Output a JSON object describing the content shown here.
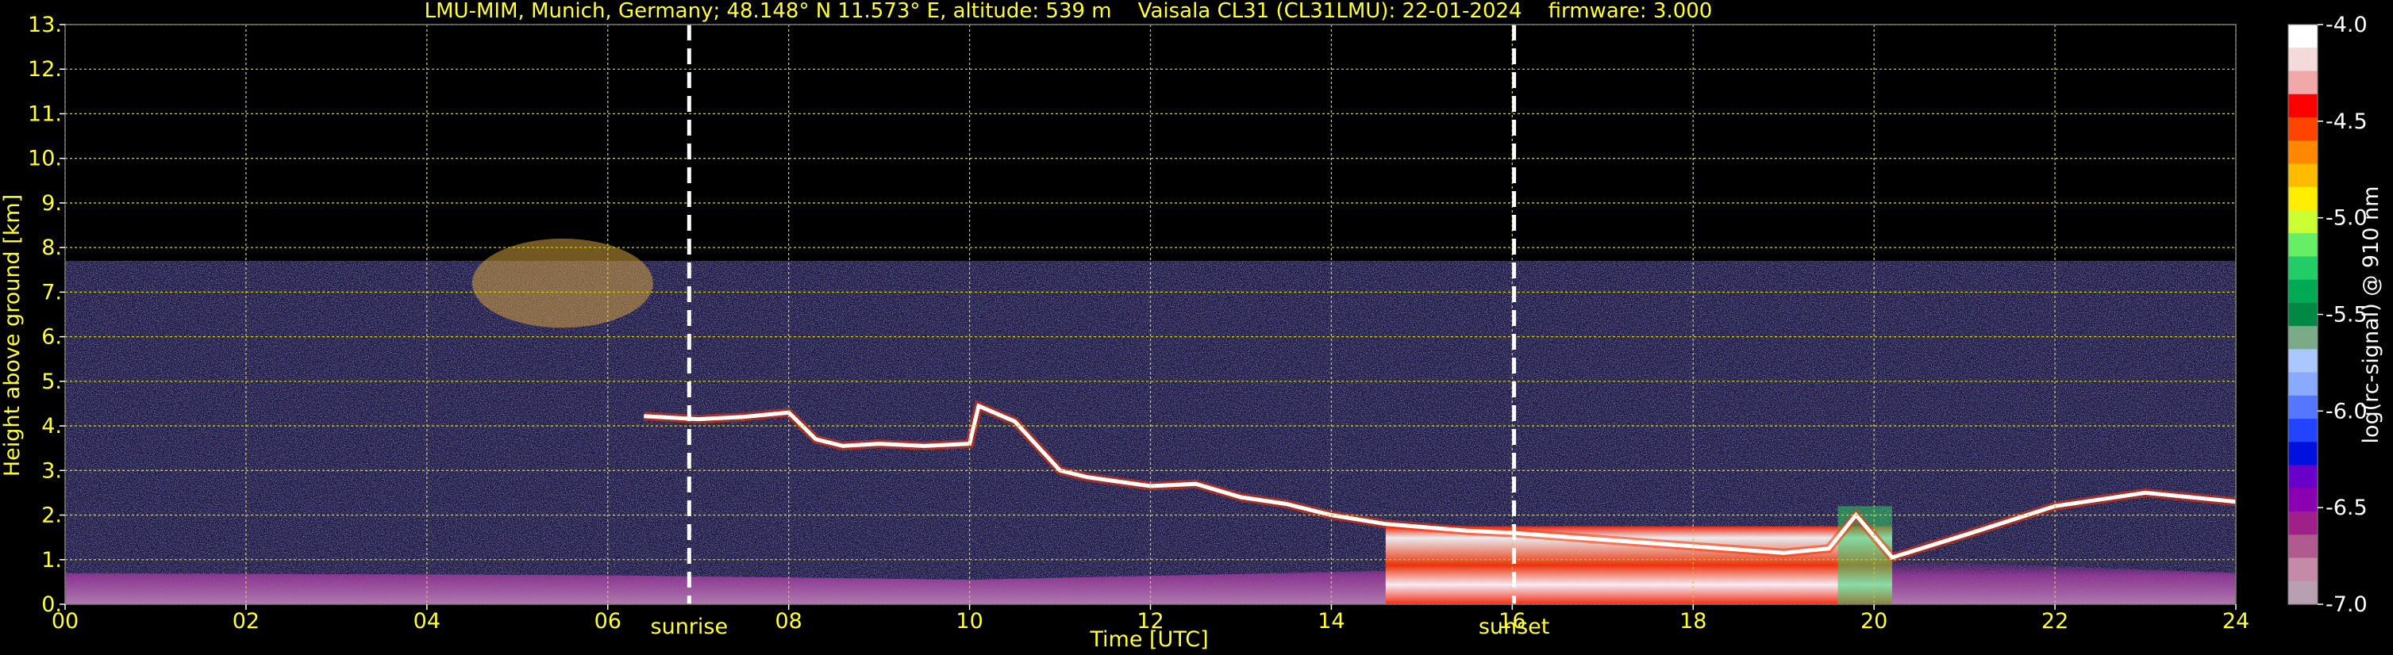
{
  "header": {
    "title": "LMU-MIM, Munich, Germany; 48.148° N 11.573° E, altitude: 539 m    Vaisala CL31 (CL31LMU): 22-01-2024    firmware: 3.000"
  },
  "colors": {
    "background": "#000000",
    "text": "#ffff33",
    "grid": "#cccc22",
    "marker_lines": "#ffffff",
    "colorbar_label": "#ffffff"
  },
  "chart_data": {
    "type": "heatmap",
    "title": "LMU-MIM, Munich, Germany; 48.148° N 11.573° E, altitude: 539 m    Vaisala CL31 (CL31LMU): 22-01-2024    firmware: 3.000",
    "xlabel": "Time [UTC]",
    "ylabel": "Height above ground [km]",
    "xlim": [
      0,
      24
    ],
    "ylim": [
      0,
      13
    ],
    "x_ticks": [
      "00",
      "02",
      "04",
      "06",
      "08",
      "10",
      "12",
      "14",
      "16",
      "18",
      "20",
      "22",
      "24"
    ],
    "y_ticks": [
      "0.",
      "1.",
      "2.",
      "3.",
      "4.",
      "5.",
      "6.",
      "7.",
      "8.",
      "9.",
      "10.",
      "11.",
      "12.",
      "13."
    ],
    "grid": true,
    "markers": [
      {
        "label": "sunrise",
        "x": 6.9
      },
      {
        "label": "sunset",
        "x": 16.02
      }
    ],
    "colorbar": {
      "label": "log(rc-signal) @ 910 nm",
      "range": [
        -7.0,
        -4.0
      ],
      "ticks": [
        "-4.0",
        "-4.5",
        "-5.0",
        "-5.5",
        "-6.0",
        "-6.5",
        "-7.0"
      ],
      "colors": [
        "#ffffff",
        "#f4dada",
        "#f0a8a8",
        "#ff0000",
        "#ff4400",
        "#ff8800",
        "#ffbb00",
        "#ffee00",
        "#ccff33",
        "#66ee66",
        "#22cc66",
        "#00aa55",
        "#008844",
        "#7aaa88",
        "#aac8ff",
        "#8aaaff",
        "#5577ff",
        "#2244ff",
        "#0011dd",
        "#6a00c8",
        "#8a00b0",
        "#a0208a",
        "#b05a90",
        "#c48aa8",
        "#b8a0b0"
      ]
    },
    "features": [
      {
        "name": "cloud layer",
        "points": [
          [
            6.4,
            4.22
          ],
          [
            7.0,
            4.15
          ],
          [
            7.5,
            4.2
          ],
          [
            8.0,
            4.3
          ],
          [
            8.3,
            3.7
          ],
          [
            8.6,
            3.55
          ],
          [
            9.0,
            3.6
          ],
          [
            9.5,
            3.55
          ],
          [
            10.0,
            3.6
          ],
          [
            10.1,
            4.45
          ],
          [
            10.5,
            4.1
          ],
          [
            11.0,
            3.0
          ],
          [
            11.3,
            2.85
          ],
          [
            12.0,
            2.65
          ],
          [
            12.5,
            2.7
          ],
          [
            13.0,
            2.4
          ],
          [
            13.5,
            2.25
          ],
          [
            14.0,
            2.0
          ],
          [
            14.6,
            1.8
          ],
          [
            15.5,
            1.65
          ],
          [
            16.0,
            1.6
          ],
          [
            17.0,
            1.45
          ],
          [
            18.0,
            1.3
          ],
          [
            19.0,
            1.15
          ],
          [
            19.5,
            1.25
          ],
          [
            19.8,
            2.0
          ],
          [
            20.2,
            1.05
          ],
          [
            21.0,
            1.55
          ],
          [
            22.0,
            2.2
          ],
          [
            23.0,
            2.5
          ],
          [
            24.0,
            2.3
          ]
        ]
      },
      {
        "name": "boundary layer",
        "points": [
          [
            0,
            0.7
          ],
          [
            6,
            0.65
          ],
          [
            10,
            0.55
          ],
          [
            14.6,
            0.75
          ],
          [
            16,
            1.0
          ],
          [
            20,
            1.0
          ],
          [
            24,
            0.7
          ]
        ]
      }
    ]
  }
}
